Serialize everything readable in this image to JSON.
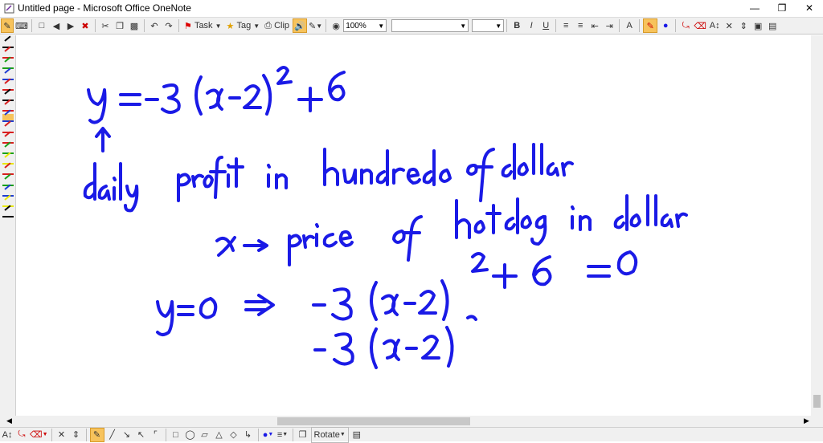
{
  "window": {
    "title": "Untitled page - Microsoft Office OneNote"
  },
  "toolbar": {
    "task_label": "Task",
    "tag_label": "Tag",
    "clip_label": "Clip",
    "zoom_value": "100%",
    "font_name": "",
    "font_size": "",
    "bold": "B",
    "italic": "I",
    "underline": "U"
  },
  "bottom_toolbar": {
    "rotate_label": "Rotate"
  },
  "pens": [
    "#000000",
    "#d81e1e",
    "#19a019",
    "#1e3cd2",
    "#d81e1e",
    "#000000",
    "#d81e1e",
    "#1e3cd2",
    "#d81e1e",
    "#d81e1e",
    "#19a019",
    "#e8e800",
    "#d81e1e",
    "#19a019",
    "#1e3cd2",
    "#e8e800",
    "#000000"
  ],
  "ink_color": "#1a1ae6",
  "ink_text": "y = -3 (x-2)^2 + 6 ; daily profit in hundreds of dollars ; x -> price of hotdog in dollars ; y=0 => -3(x-2)^2 + 6 = 0 ; -3(x-2)^2"
}
